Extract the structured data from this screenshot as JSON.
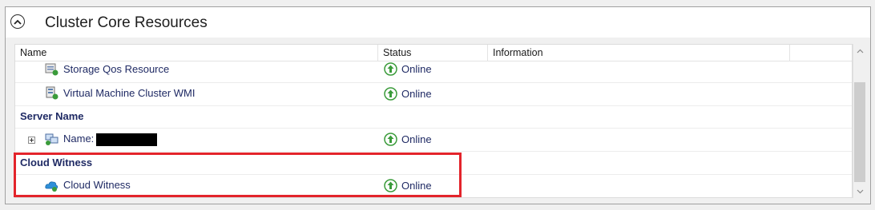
{
  "section": {
    "title": "Cluster Core Resources",
    "collapse_icon": "chevron-up-circle-icon"
  },
  "columns": {
    "name": "Name",
    "status": "Status",
    "information": "Information"
  },
  "rows_top": [
    {
      "name": "Storage Qos Resource",
      "icon": "storage-qos-icon",
      "status": "Online"
    },
    {
      "name": "Virtual Machine Cluster WMI",
      "icon": "vm-cluster-wmi-icon",
      "status": "Online"
    }
  ],
  "server_group": {
    "label": "Server Name",
    "item": {
      "name": "Name:",
      "icon": "network-name-icon",
      "status": "Online",
      "value_redacted": true
    }
  },
  "witness_group": {
    "label": "Cloud Witness",
    "item": {
      "name": "Cloud Witness",
      "icon": "cloud-witness-icon",
      "status": "Online"
    }
  },
  "colors": {
    "highlight": "#e3242b",
    "link_text": "#1f2a64",
    "online_green": "#3a9b3a"
  }
}
